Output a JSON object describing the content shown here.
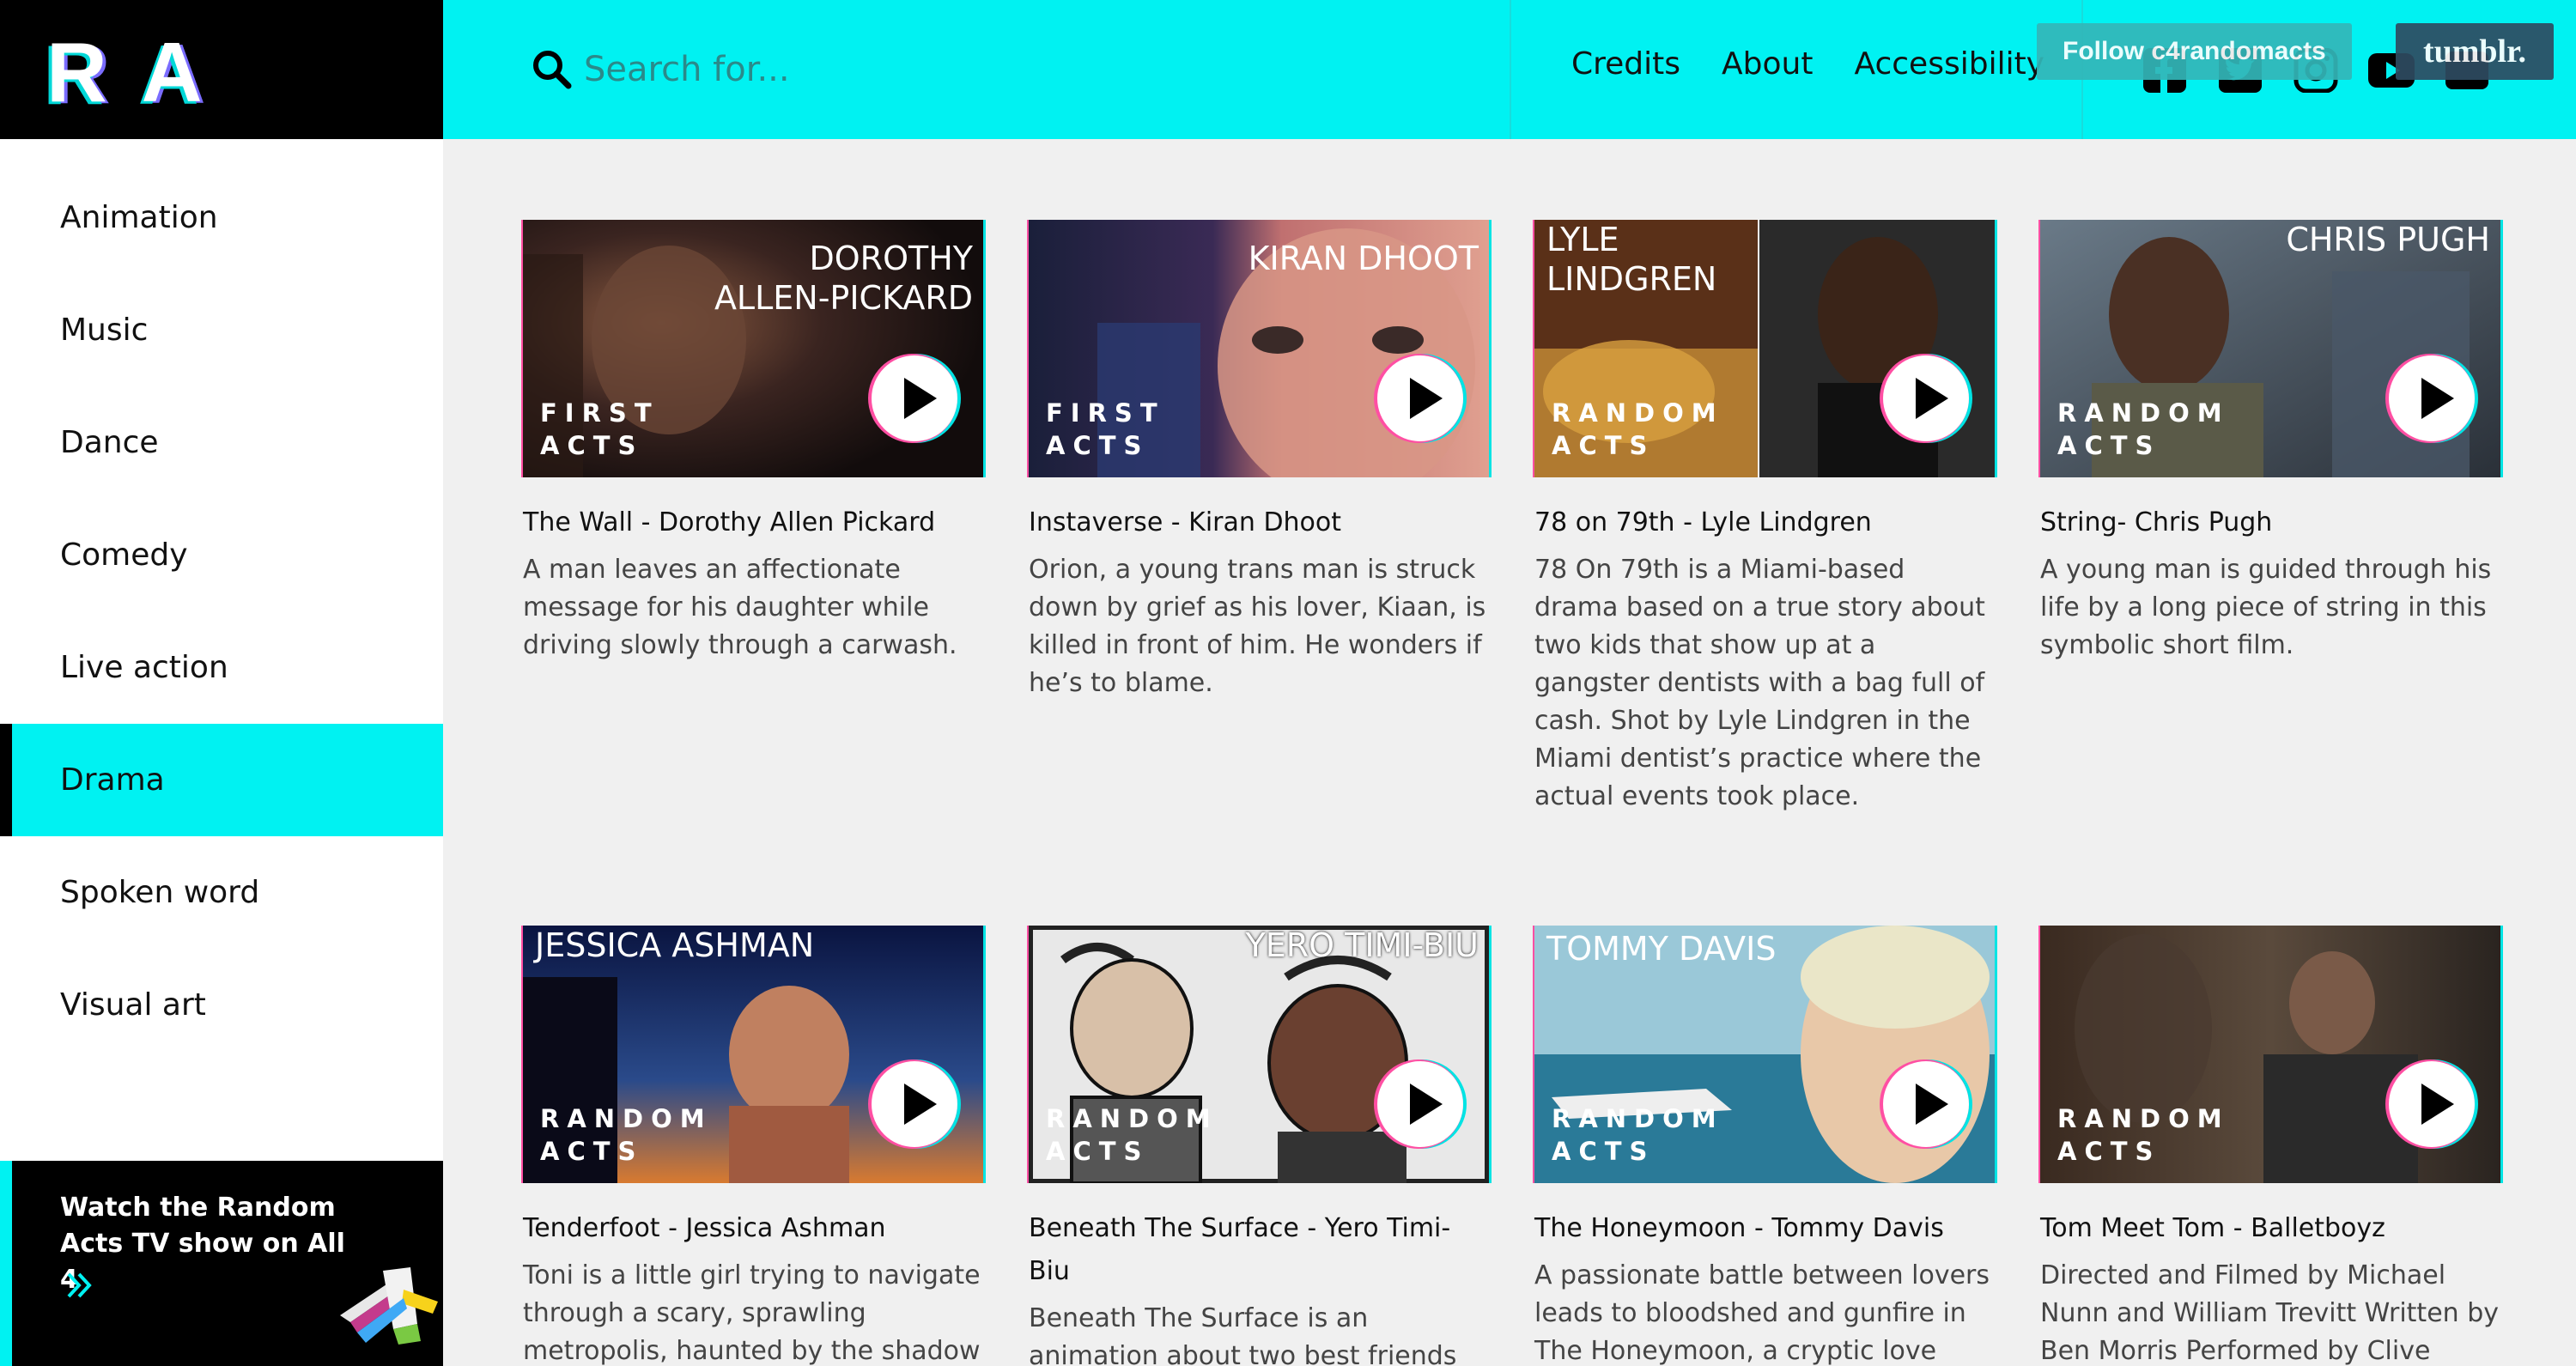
{
  "logo": {
    "text": "RA"
  },
  "nav": {
    "items": [
      {
        "label": "Animation"
      },
      {
        "label": "Music"
      },
      {
        "label": "Dance"
      },
      {
        "label": "Comedy"
      },
      {
        "label": "Live action"
      },
      {
        "label": "Drama",
        "active": true
      },
      {
        "label": "Spoken word"
      },
      {
        "label": "Visual art"
      }
    ]
  },
  "promo": {
    "text": "Watch the Random Acts TV show on All 4"
  },
  "search": {
    "placeholder": "Search for..."
  },
  "header_links": [
    "Credits",
    "About",
    "Accessibility"
  ],
  "social_icons": [
    "facebook-icon",
    "twitter-icon",
    "instagram-icon",
    "youtube-icon",
    "more-icon"
  ],
  "follow": {
    "label": "Follow c4randomacts"
  },
  "tumblr": {
    "label": "tumblr."
  },
  "colors": {
    "accent": "#00f2f2",
    "black": "#000000",
    "background": "#f0f0f0"
  },
  "cards": [
    {
      "thumb_name": "DOROTHY\nALLEN-PICKARD",
      "brand": "FIRST ACTS",
      "title": "The Wall - Dorothy Allen Pickard",
      "desc": "A man leaves an affectionate message for his daughter while driving slowly through a carwash."
    },
    {
      "thumb_name": "KIRAN DHOOT",
      "brand": "FIRST ACTS",
      "title": "Instaverse - Kiran Dhoot",
      "desc": "Orion, a young trans man is struck down by grief as his lover, Kiaan, is killed in front of him. He wonders if he’s to blame."
    },
    {
      "thumb_name": "LYLE\nLINDGREN",
      "brand": "RANDOM ACTS",
      "title": "78 on 79th - Lyle Lindgren",
      "desc": "78 On 79th is a Miami-based drama based on a true story about two kids that show up at a gangster dentists with a bag full of cash. Shot by Lyle Lindgren in the Miami dentist’s practice where the actual events took place."
    },
    {
      "thumb_name": "CHRIS PUGH",
      "brand": "RANDOM ACTS",
      "title": "String- Chris Pugh",
      "desc": "A young man is guided through his life by a long piece of string in this symbolic short film."
    },
    {
      "thumb_name": "JESSICA ASHMAN",
      "brand": "RANDOM ACTS",
      "title": "Tenderfoot - Jessica Ashman",
      "desc": "Toni is a little girl trying to navigate through a scary, sprawling metropolis, haunted by the shadow"
    },
    {
      "thumb_name": "YERO TIMI-BIU",
      "brand": "RANDOM ACTS",
      "title": "Beneath The Surface - Yero Timi-Biu",
      "desc": "Beneath The Surface is an animation about two best friends"
    },
    {
      "thumb_name": "TOMMY DAVIS",
      "brand": "RANDOM ACTS",
      "title": "The Honeymoon - Tommy Davis",
      "desc": "A passionate battle between lovers leads to bloodshed and gunfire in The Honeymoon, a cryptic love"
    },
    {
      "thumb_name": "",
      "brand": "RANDOM ACTS",
      "title": "Tom Meet Tom - Balletboyz",
      "desc": "Directed and Filmed by Michael Nunn and William Trevitt Written by Ben Morris Performed by Clive"
    }
  ]
}
